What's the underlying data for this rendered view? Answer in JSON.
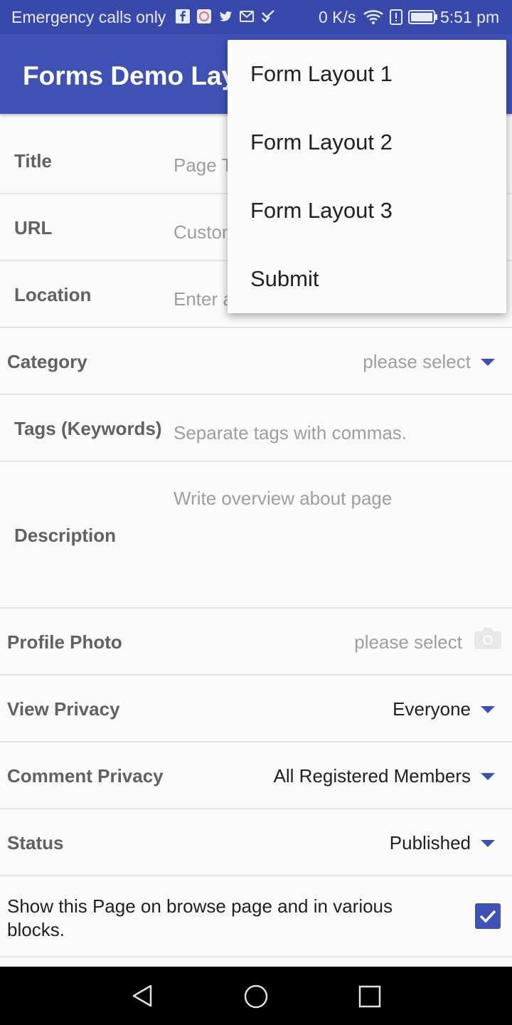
{
  "status_bar": {
    "carrier": "Emergency calls only",
    "net_speed": "0 K/s",
    "time": "5:51 pm",
    "notification_icons": [
      "facebook-icon",
      "app-icon",
      "twitter-icon",
      "mail-icon",
      "check-icon"
    ],
    "system_icons": [
      "wifi-icon",
      "alert-icon",
      "battery-icon"
    ]
  },
  "app_bar": {
    "title": "Forms Demo Layout"
  },
  "overflow_menu": {
    "items": [
      "Form Layout 1",
      "Form Layout 2",
      "Form Layout 3",
      "Submit"
    ]
  },
  "form": {
    "title": {
      "label": "Title",
      "placeholder": "Page Title"
    },
    "url": {
      "label": "URL",
      "placeholder": "Custom URL"
    },
    "location": {
      "label": "Location",
      "placeholder": "Enter a location"
    },
    "category": {
      "label": "Category",
      "value": "please select"
    },
    "tags": {
      "label": "Tags (Keywords)",
      "placeholder": "Separate tags with commas."
    },
    "description": {
      "label": "Description",
      "placeholder": "Write overview about page"
    },
    "profile_photo": {
      "label": "Profile Photo",
      "value": "please select",
      "icon": "camera-icon"
    },
    "view_privacy": {
      "label": "View Privacy",
      "value": "Everyone"
    },
    "comment_privacy": {
      "label": "Comment Privacy",
      "value": "All Registered Members"
    },
    "status": {
      "label": "Status",
      "value": "Published"
    },
    "show_on_browse": {
      "label": "Show this Page on browse page and in various blocks.",
      "checked": true
    }
  },
  "nav_bar": {
    "icons": [
      "back-icon",
      "home-icon",
      "recents-icon"
    ]
  },
  "colors": {
    "primary": "#3f51b5",
    "primary_dark": "#3949ab",
    "background": "#fafafa"
  }
}
